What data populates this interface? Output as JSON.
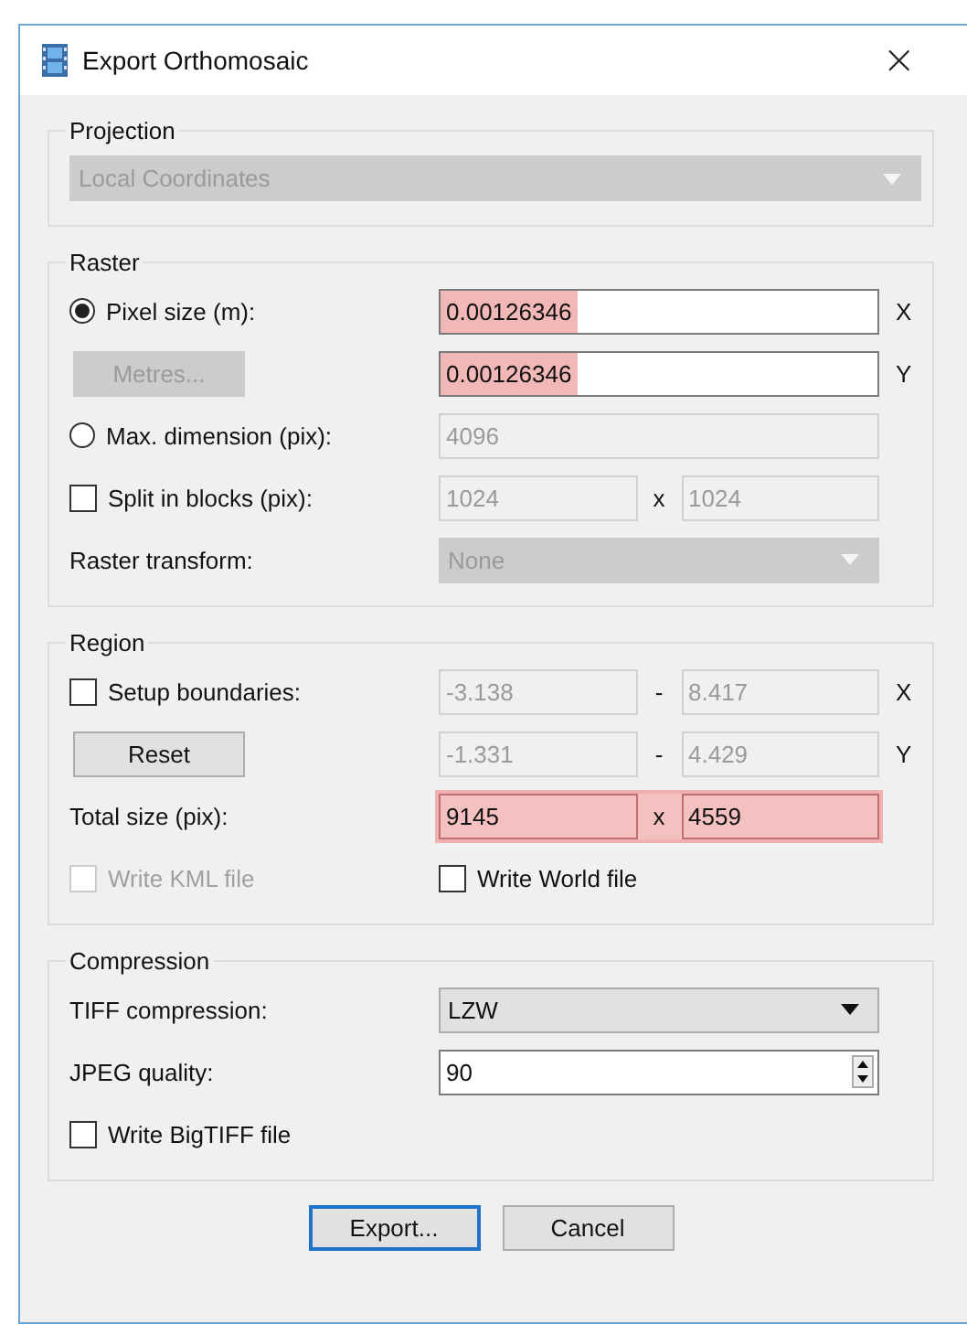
{
  "window": {
    "title": "Export Orthomosaic",
    "close": "×"
  },
  "groups": [
    {
      "title": "Projection",
      "rows": [
        {
          "kind": "select_full",
          "select": {
            "value": "Local Coordinates",
            "disabled": true
          }
        }
      ]
    },
    {
      "title": "Raster",
      "rows": [
        {
          "kind": "fields",
          "control": {
            "kind": "radio",
            "label": "Pixel size (m):",
            "selected": true
          },
          "fields": [
            {
              "value": "0.00126346",
              "disabled": false,
              "highlighted": true
            }
          ],
          "axis": "X"
        },
        {
          "kind": "fields",
          "control": {
            "kind": "button",
            "label": "Metres...",
            "disabled": true
          },
          "fields": [
            {
              "value": "0.00126346",
              "disabled": false,
              "highlighted": true
            }
          ],
          "axis": "Y"
        },
        {
          "kind": "fields",
          "control": {
            "kind": "radio",
            "label": "Max. dimension (pix):",
            "selected": false
          },
          "fields": [
            {
              "value": "4096",
              "disabled": true
            }
          ]
        },
        {
          "kind": "fields",
          "control": {
            "kind": "checkbox",
            "label": "Split in blocks (pix):",
            "checked": false,
            "disabled": false
          },
          "fields": [
            {
              "value": "1024",
              "disabled": true
            },
            {
              "value": "1024",
              "disabled": true
            }
          ],
          "separator": "x"
        },
        {
          "kind": "select",
          "control": {
            "kind": "label",
            "label": "Raster transform:"
          },
          "select": {
            "value": "None",
            "disabled": true
          }
        }
      ]
    },
    {
      "title": "Region",
      "rows": [
        {
          "kind": "fields",
          "control": {
            "kind": "checkbox",
            "label": "Setup boundaries:",
            "checked": false,
            "disabled": false
          },
          "fields": [
            {
              "value": "-3.138",
              "disabled": true
            },
            {
              "value": "8.417",
              "disabled": true
            }
          ],
          "separator": "-",
          "axis": "X"
        },
        {
          "kind": "fields",
          "control": {
            "kind": "button",
            "label": "Reset",
            "disabled": false
          },
          "fields": [
            {
              "value": "-1.331",
              "disabled": true
            },
            {
              "value": "4.429",
              "disabled": true
            }
          ],
          "separator": "-",
          "axis": "Y"
        },
        {
          "kind": "fields",
          "control": {
            "kind": "label",
            "label": "Total size (pix):"
          },
          "fields": [
            {
              "value": "9145",
              "disabled": false
            },
            {
              "value": "4559",
              "disabled": false
            }
          ],
          "separator": "x",
          "highlighted": true
        },
        {
          "kind": "checks",
          "control": {
            "kind": "checkbox",
            "label": "Write KML file",
            "checked": false,
            "disabled": true
          },
          "aside": {
            "kind": "checkbox",
            "label": "Write World file",
            "checked": false,
            "disabled": false
          }
        }
      ]
    },
    {
      "title": "Compression",
      "rows": [
        {
          "kind": "select",
          "control": {
            "kind": "label",
            "label": "TIFF compression:"
          },
          "select": {
            "value": "LZW",
            "disabled": false
          }
        },
        {
          "kind": "spin",
          "control": {
            "kind": "label",
            "label": "JPEG quality:"
          },
          "value": "90"
        },
        {
          "kind": "checks",
          "control": {
            "kind": "checkbox",
            "label": "Write BigTIFF file",
            "checked": false,
            "disabled": false
          }
        }
      ]
    }
  ],
  "buttons": [
    {
      "label": "Export...",
      "default": true
    },
    {
      "label": "Cancel",
      "default": false
    }
  ]
}
